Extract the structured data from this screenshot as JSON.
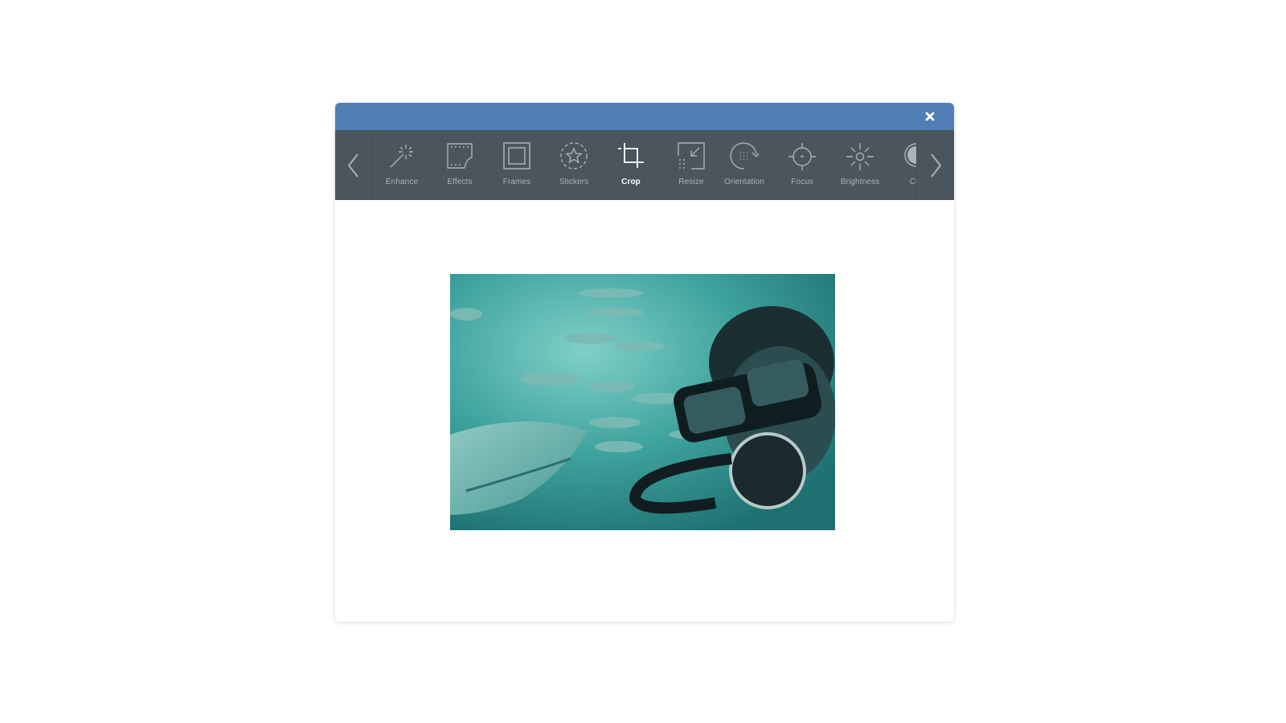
{
  "dialog": {
    "close_icon": "close-icon",
    "colors": {
      "titlebar": "#4f7fb4",
      "toolbar": "#4b555e",
      "label": "#aab2ba",
      "active_label": "#ffffff"
    }
  },
  "toolbar": {
    "prev_icon": "chevron-left-icon",
    "next_icon": "chevron-right-icon",
    "active_tool": "Crop",
    "tools": [
      {
        "label": "Enhance",
        "icon": "magic-wand-icon"
      },
      {
        "label": "Effects",
        "icon": "film-effects-icon"
      },
      {
        "label": "Frames",
        "icon": "frame-icon"
      },
      {
        "label": "Stickers",
        "icon": "star-sticker-icon"
      },
      {
        "label": "Crop",
        "icon": "crop-icon"
      },
      {
        "label": "Resize",
        "icon": "resize-icon"
      },
      {
        "label": "Orientation",
        "icon": "rotate-icon"
      },
      {
        "label": "Focus",
        "icon": "focus-crosshair-icon"
      },
      {
        "label": "Brightness",
        "icon": "sun-icon"
      },
      {
        "label": "Cor",
        "icon": "contrast-icon"
      }
    ]
  },
  "canvas": {
    "image_description": "Underwater selfie of a scuba diver with mask and regulator, school of fish and a shark, teal tint"
  }
}
